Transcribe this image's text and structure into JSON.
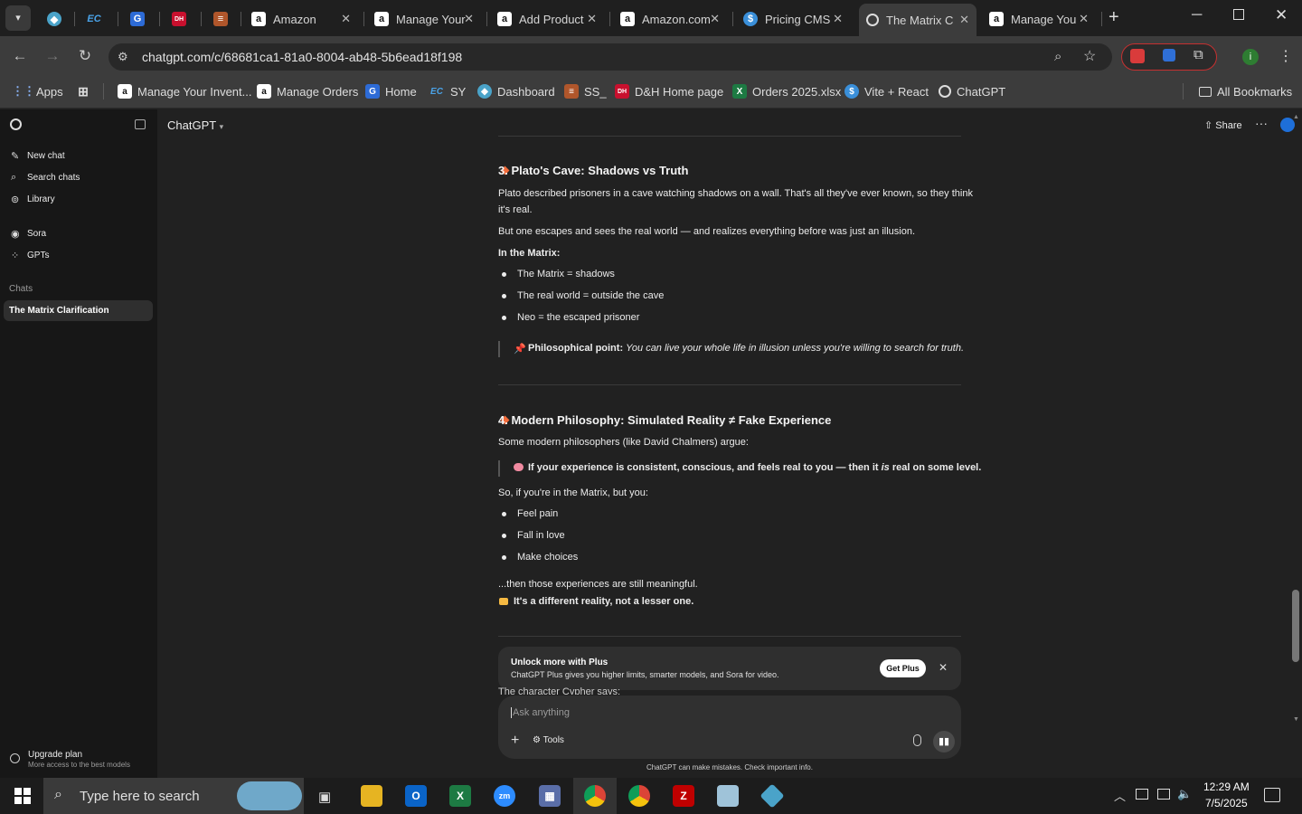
{
  "browser": {
    "tabs": [
      {
        "title": "",
        "icon": "tab-pin-icon"
      },
      {
        "title": "",
        "icon": "ec-icon"
      },
      {
        "title": "",
        "icon": "g-doc-icon"
      },
      {
        "title": "",
        "icon": "dh-icon"
      },
      {
        "title": "",
        "icon": "layers-icon"
      },
      {
        "title": "Amazon",
        "icon": "amazon-icon"
      },
      {
        "title": "Manage Your",
        "icon": "amazon-icon"
      },
      {
        "title": "Add Product",
        "icon": "amazon-icon"
      },
      {
        "title": "Amazon.com",
        "icon": "amazon-icon"
      },
      {
        "title": "Pricing CMS",
        "icon": "dollar-icon"
      },
      {
        "title": "The Matrix C",
        "icon": "chatgpt-icon"
      },
      {
        "title": "Manage You",
        "icon": "amazon-icon"
      }
    ],
    "url": "chatgpt.com/c/68681ca1-81a0-8004-ab48-5b6ead18f198",
    "bookmarks": [
      "Apps",
      "Manage Your Invent...",
      "Manage Orders",
      "Home",
      "SY",
      "Dashboard",
      "SS_",
      "D&H Home page",
      "Orders 2025.xlsx",
      "Vite + React",
      "ChatGPT"
    ],
    "all_bookmarks": "All Bookmarks",
    "profile_initial": "i"
  },
  "sidebar": {
    "items": [
      "New chat",
      "Search chats",
      "Library",
      "Sora",
      "GPTs"
    ],
    "chats_label": "Chats",
    "active_chat": "The Matrix Clarification",
    "upgrade_title": "Upgrade plan",
    "upgrade_sub": "More access to the best models"
  },
  "header": {
    "model": "ChatGPT",
    "share": "Share"
  },
  "content": {
    "s3_title": "3. Plato's Cave: Shadows vs Truth",
    "s3_p1a": "Plato described prisoners in a cave watching shadows on a wall. That's all they've ever known, so they think",
    "s3_p1b": "it's real.",
    "s3_p2": "But one escapes and sees the real world — and realizes everything before was just an illusion.",
    "s3_in_matrix": "In the Matrix:",
    "s3_list": [
      "The Matrix = shadows",
      "The real world = outside the cave",
      "Neo = the escaped prisoner"
    ],
    "s3_quote_label": "Philosophical point:",
    "s3_quote_text": "You can live your whole life in illusion unless you're willing to search for truth.",
    "s4_title": "4. Modern Philosophy: Simulated Reality ≠ Fake Experience",
    "s4_p1": "Some modern philosophers (like David Chalmers) argue:",
    "s4_quote_a": "If your experience is consistent, conscious, and feels real to you — then it",
    "s4_quote_is": "is",
    "s4_quote_b": "real on some level.",
    "s4_p2": "So, if you're in the Matrix, but you:",
    "s4_list": [
      "Feel pain",
      "Fall in love",
      "Make choices"
    ],
    "s4_p3": "...then those experiences are still meaningful.",
    "s4_p4": "It's a different reality, not a lesser one.",
    "cut_text": "The character Cypher says:"
  },
  "promo": {
    "title": "Unlock more with Plus",
    "sub": "ChatGPT Plus gives you higher limits, smarter models, and Sora for video.",
    "button": "Get Plus"
  },
  "composer": {
    "placeholder": "Ask anything",
    "tools": "Tools",
    "disclaimer": "ChatGPT can make mistakes. Check important info."
  },
  "taskbar": {
    "search_placeholder": "Type here to search",
    "time": "12:29 AM",
    "date": "7/5/2025"
  },
  "colors": {
    "accent_blue": "#1e6fd9",
    "diamond": "#f26b3a",
    "sidebar_active": "#2f2f2f"
  }
}
